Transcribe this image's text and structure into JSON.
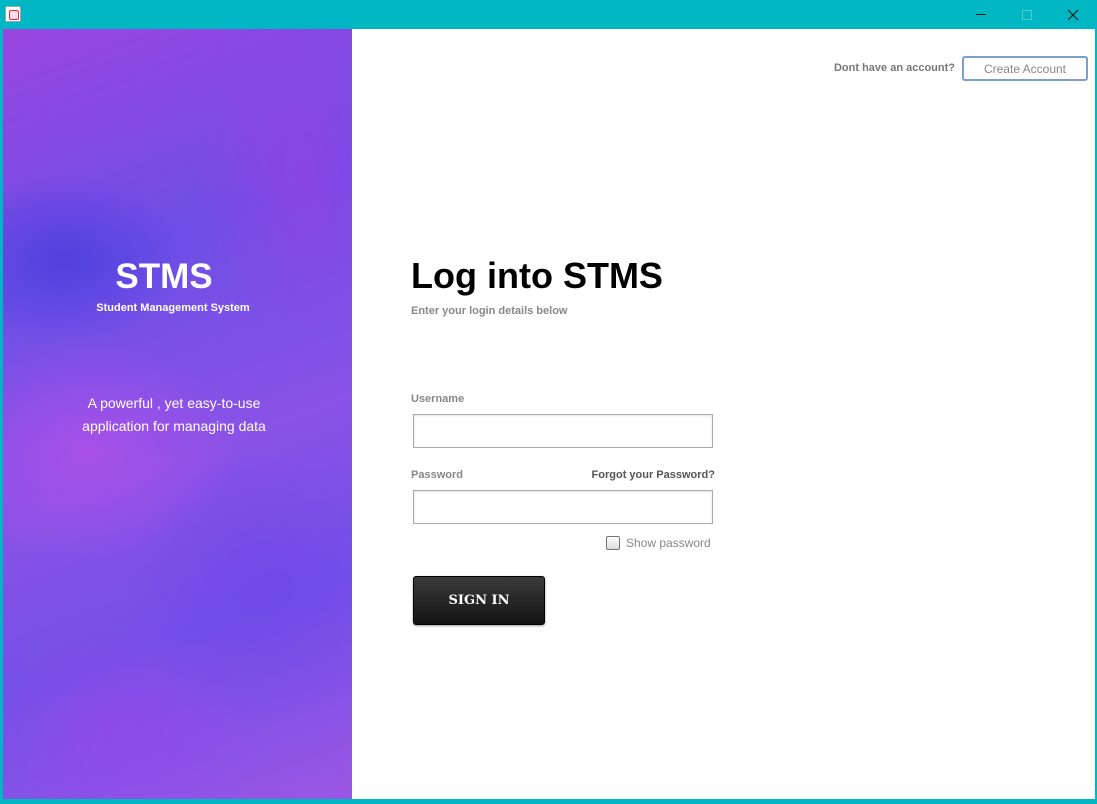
{
  "window": {
    "title": "",
    "controls": {
      "minimize": "minimize-icon",
      "maximize": "maximize-icon",
      "close": "close-icon"
    }
  },
  "sidebar": {
    "brand": "STMS",
    "brand_subtitle": "Student Management System",
    "tagline": "A powerful , yet easy-to-use application for managing data"
  },
  "header": {
    "signup_prompt": "Dont have an account?",
    "create_account_label": "Create Account"
  },
  "login": {
    "title": "Log into STMS",
    "subtitle": "Enter your login details below",
    "username_label": "Username",
    "username_value": "",
    "password_label": "Password",
    "password_value": "",
    "forgot_label": "Forgot your Password?",
    "show_password_label": "Show password",
    "show_password_checked": false,
    "signin_label": "SIGN IN"
  },
  "colors": {
    "titlebar": "#00b7c3",
    "sidebar_primary": "#7350e8",
    "sidebar_secondary": "#9a45e0",
    "button_dark": "#1f1f1f"
  }
}
